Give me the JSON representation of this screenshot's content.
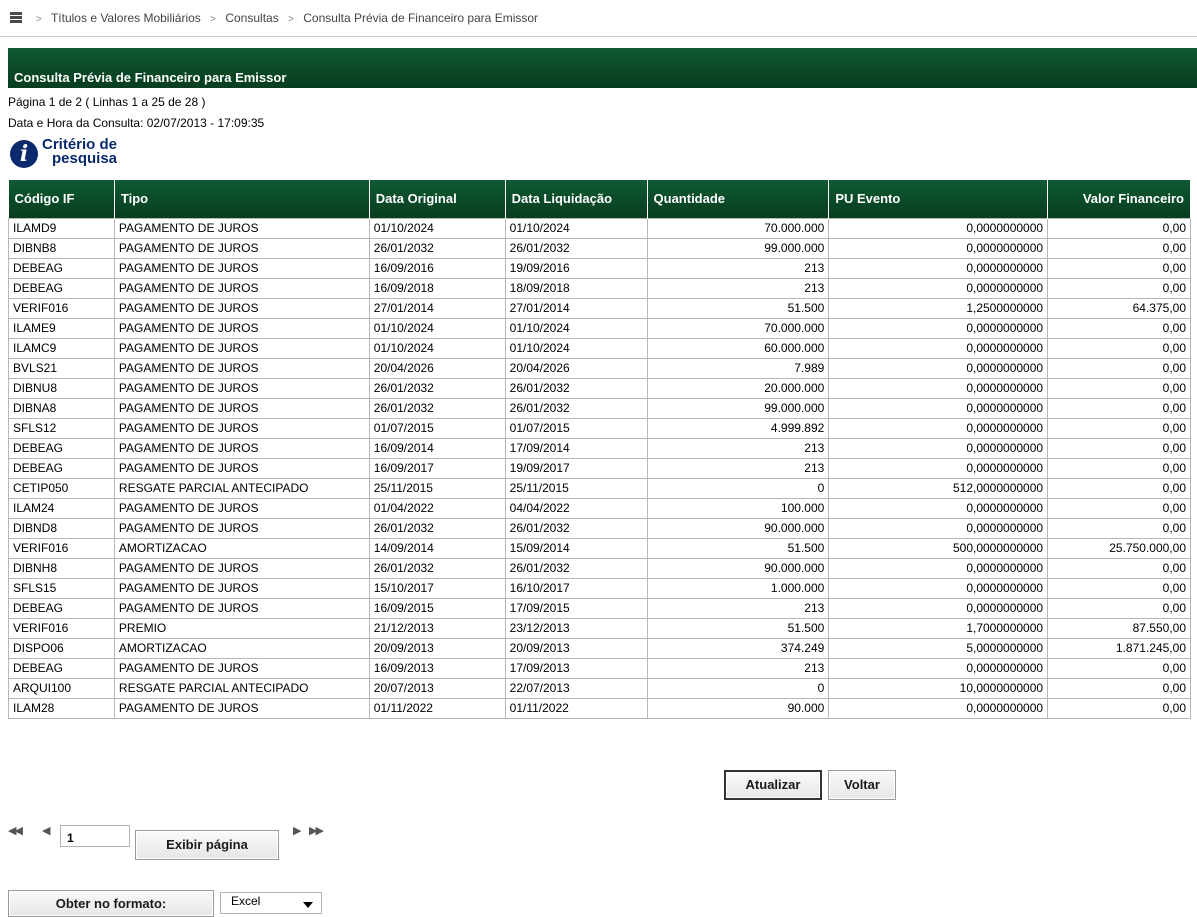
{
  "breadcrumb": [
    "Títulos e Valores Mobiliários",
    "Consultas",
    "Consulta Prévia de Financeiro para Emissor"
  ],
  "title": "Consulta Prévia de Financeiro para Emissor",
  "page_info": "Página 1 de 2 ( Linhas 1 a 25 de 28 )",
  "query_datetime": "Data e Hora da Consulta: 02/07/2013 - 17:09:35",
  "criteria": {
    "line1": "Critério de",
    "line2": "pesquisa"
  },
  "table": {
    "columns": [
      "Código IF",
      "Tipo",
      "Data Original",
      "Data Liquidação",
      "Quantidade",
      "PU Evento",
      "Valor Financeiro"
    ],
    "rows": [
      [
        "ILAMD9",
        "PAGAMENTO DE JUROS",
        "01/10/2024",
        "01/10/2024",
        "70.000.000",
        "0,0000000000",
        "0,00"
      ],
      [
        "DIBNB8",
        "PAGAMENTO DE JUROS",
        "26/01/2032",
        "26/01/2032",
        "99.000.000",
        "0,0000000000",
        "0,00"
      ],
      [
        "DEBEAG",
        "PAGAMENTO DE JUROS",
        "16/09/2016",
        "19/09/2016",
        "213",
        "0,0000000000",
        "0,00"
      ],
      [
        "DEBEAG",
        "PAGAMENTO DE JUROS",
        "16/09/2018",
        "18/09/2018",
        "213",
        "0,0000000000",
        "0,00"
      ],
      [
        "VERIF016",
        "PAGAMENTO DE JUROS",
        "27/01/2014",
        "27/01/2014",
        "51.500",
        "1,2500000000",
        "64.375,00"
      ],
      [
        "ILAME9",
        "PAGAMENTO DE JUROS",
        "01/10/2024",
        "01/10/2024",
        "70.000.000",
        "0,0000000000",
        "0,00"
      ],
      [
        "ILAMC9",
        "PAGAMENTO DE JUROS",
        "01/10/2024",
        "01/10/2024",
        "60.000.000",
        "0,0000000000",
        "0,00"
      ],
      [
        "BVLS21",
        "PAGAMENTO DE JUROS",
        "20/04/2026",
        "20/04/2026",
        "7.989",
        "0,0000000000",
        "0,00"
      ],
      [
        "DIBNU8",
        "PAGAMENTO DE JUROS",
        "26/01/2032",
        "26/01/2032",
        "20.000.000",
        "0,0000000000",
        "0,00"
      ],
      [
        "DIBNA8",
        "PAGAMENTO DE JUROS",
        "26/01/2032",
        "26/01/2032",
        "99.000.000",
        "0,0000000000",
        "0,00"
      ],
      [
        "SFLS12",
        "PAGAMENTO DE JUROS",
        "01/07/2015",
        "01/07/2015",
        "4.999.892",
        "0,0000000000",
        "0,00"
      ],
      [
        "DEBEAG",
        "PAGAMENTO DE JUROS",
        "16/09/2014",
        "17/09/2014",
        "213",
        "0,0000000000",
        "0,00"
      ],
      [
        "DEBEAG",
        "PAGAMENTO DE JUROS",
        "16/09/2017",
        "19/09/2017",
        "213",
        "0,0000000000",
        "0,00"
      ],
      [
        "CETIP050",
        "RESGATE PARCIAL ANTECIPADO",
        "25/11/2015",
        "25/11/2015",
        "0",
        "512,0000000000",
        "0,00"
      ],
      [
        "ILAM24",
        "PAGAMENTO DE JUROS",
        "01/04/2022",
        "04/04/2022",
        "100.000",
        "0,0000000000",
        "0,00"
      ],
      [
        "DIBND8",
        "PAGAMENTO DE JUROS",
        "26/01/2032",
        "26/01/2032",
        "90.000.000",
        "0,0000000000",
        "0,00"
      ],
      [
        "VERIF016",
        "AMORTIZACAO",
        "14/09/2014",
        "15/09/2014",
        "51.500",
        "500,0000000000",
        "25.750.000,00"
      ],
      [
        "DIBNH8",
        "PAGAMENTO DE JUROS",
        "26/01/2032",
        "26/01/2032",
        "90.000.000",
        "0,0000000000",
        "0,00"
      ],
      [
        "SFLS15",
        "PAGAMENTO DE JUROS",
        "15/10/2017",
        "16/10/2017",
        "1.000.000",
        "0,0000000000",
        "0,00"
      ],
      [
        "DEBEAG",
        "PAGAMENTO DE JUROS",
        "16/09/2015",
        "17/09/2015",
        "213",
        "0,0000000000",
        "0,00"
      ],
      [
        "VERIF016",
        "PREMIO",
        "21/12/2013",
        "23/12/2013",
        "51.500",
        "1,7000000000",
        "87.550,00"
      ],
      [
        "DISPO06",
        "AMORTIZACAO",
        "20/09/2013",
        "20/09/2013",
        "374.249",
        "5,0000000000",
        "1.871.245,00"
      ],
      [
        "DEBEAG",
        "PAGAMENTO DE JUROS",
        "16/09/2013",
        "17/09/2013",
        "213",
        "0,0000000000",
        "0,00"
      ],
      [
        "ARQUI100",
        "RESGATE PARCIAL ANTECIPADO",
        "20/07/2013",
        "22/07/2013",
        "0",
        "10,0000000000",
        "0,00"
      ],
      [
        "ILAM28",
        "PAGAMENTO DE JUROS",
        "01/11/2022",
        "01/11/2022",
        "90.000",
        "0,0000000000",
        "0,00"
      ]
    ]
  },
  "buttons": {
    "refresh": "Atualizar",
    "back": "Voltar",
    "show_page": "Exibir página",
    "export": "Obter no formato:"
  },
  "pager": {
    "current_page": "1",
    "first": "◀◀",
    "prev": "◀",
    "next": "▶",
    "last": "▶▶"
  },
  "export_format": "Excel",
  "icons": {
    "menu": "menu-icon",
    "info": "info-icon"
  },
  "colors": {
    "header_green": "#0a4a28",
    "info_blue": "#0b2a6e"
  }
}
